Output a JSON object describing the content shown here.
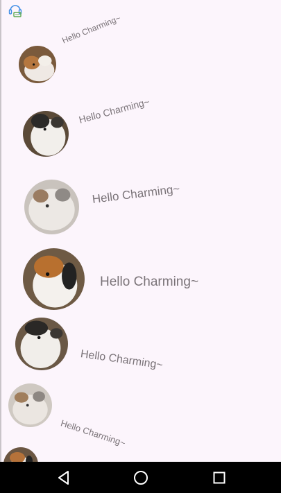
{
  "list": {
    "items": [
      {
        "caption": "Hello Charming~"
      },
      {
        "caption": "Hello Charming~"
      },
      {
        "caption": "Hello Charming~"
      },
      {
        "caption": "Hello Charming~"
      },
      {
        "caption": "Hello Charming~"
      },
      {
        "caption": "Hello Charming~"
      },
      {
        "caption": ""
      }
    ]
  },
  "icons": {
    "app_icon": "support-agent-icon",
    "nav_back": "back-triangle-icon",
    "nav_home": "home-circle-icon",
    "nav_recents": "recents-square-icon"
  },
  "colors": {
    "background": "#FCF5FC",
    "caption": "#7A7378",
    "accent": "#3F8EE6",
    "nav_bar": "#000000"
  }
}
